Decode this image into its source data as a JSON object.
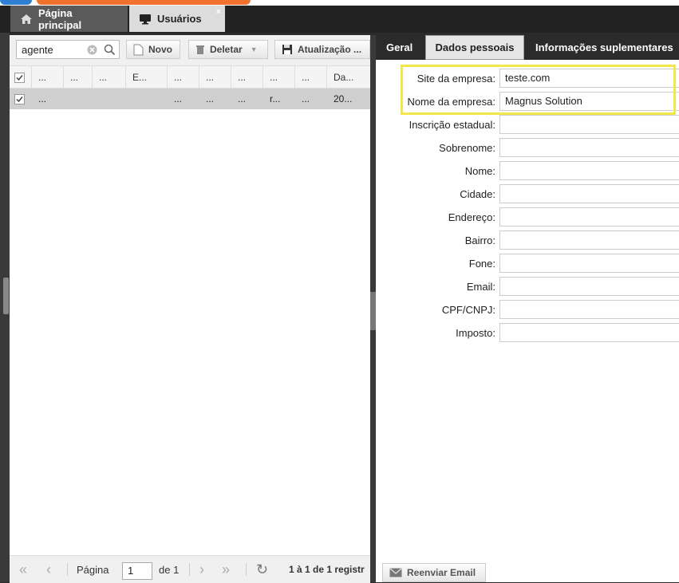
{
  "tabs": {
    "home_label": "Página principal",
    "users_label": "Usuários",
    "close_glyph": "×"
  },
  "toolbar": {
    "search_value": "agente",
    "new_label": "Novo",
    "delete_label": "Deletar",
    "update_label": "Atualização ..."
  },
  "grid": {
    "headers": [
      "...",
      "...",
      "E...",
      "...",
      "...",
      "...",
      "...",
      "...",
      "Da..."
    ],
    "row": [
      "...",
      "",
      "",
      "...",
      "...",
      "...",
      "r...",
      "...",
      "20..."
    ]
  },
  "pager": {
    "page_label": "Página",
    "page_value": "1",
    "of_label": "de 1",
    "summary": "1 à 1 de 1 registr"
  },
  "form_tabs": {
    "general": "Geral",
    "personal": "Dados pessoais",
    "extra": "Informações suplementares"
  },
  "form": {
    "fields": [
      {
        "label": "Site da empresa:",
        "value": "teste.com"
      },
      {
        "label": "Nome da empresa:",
        "value": "Magnus Solution"
      },
      {
        "label": "Inscrição estadual:",
        "value": ""
      },
      {
        "label": "Sobrenome:",
        "value": ""
      },
      {
        "label": "Nome:",
        "value": ""
      },
      {
        "label": "Cidade:",
        "value": ""
      },
      {
        "label": "Endereço:",
        "value": ""
      },
      {
        "label": "Bairro:",
        "value": ""
      },
      {
        "label": "Fone:",
        "value": ""
      },
      {
        "label": "Email:",
        "value": ""
      },
      {
        "label": "CPF/CNPJ:",
        "value": ""
      },
      {
        "label": "Imposto:",
        "value": ""
      }
    ],
    "resend_label": "Reenviar Email"
  },
  "colors": {
    "highlight": "#f2e84a",
    "logo_blue": "#2f7fd4",
    "logo_orange": "#f0722c"
  }
}
